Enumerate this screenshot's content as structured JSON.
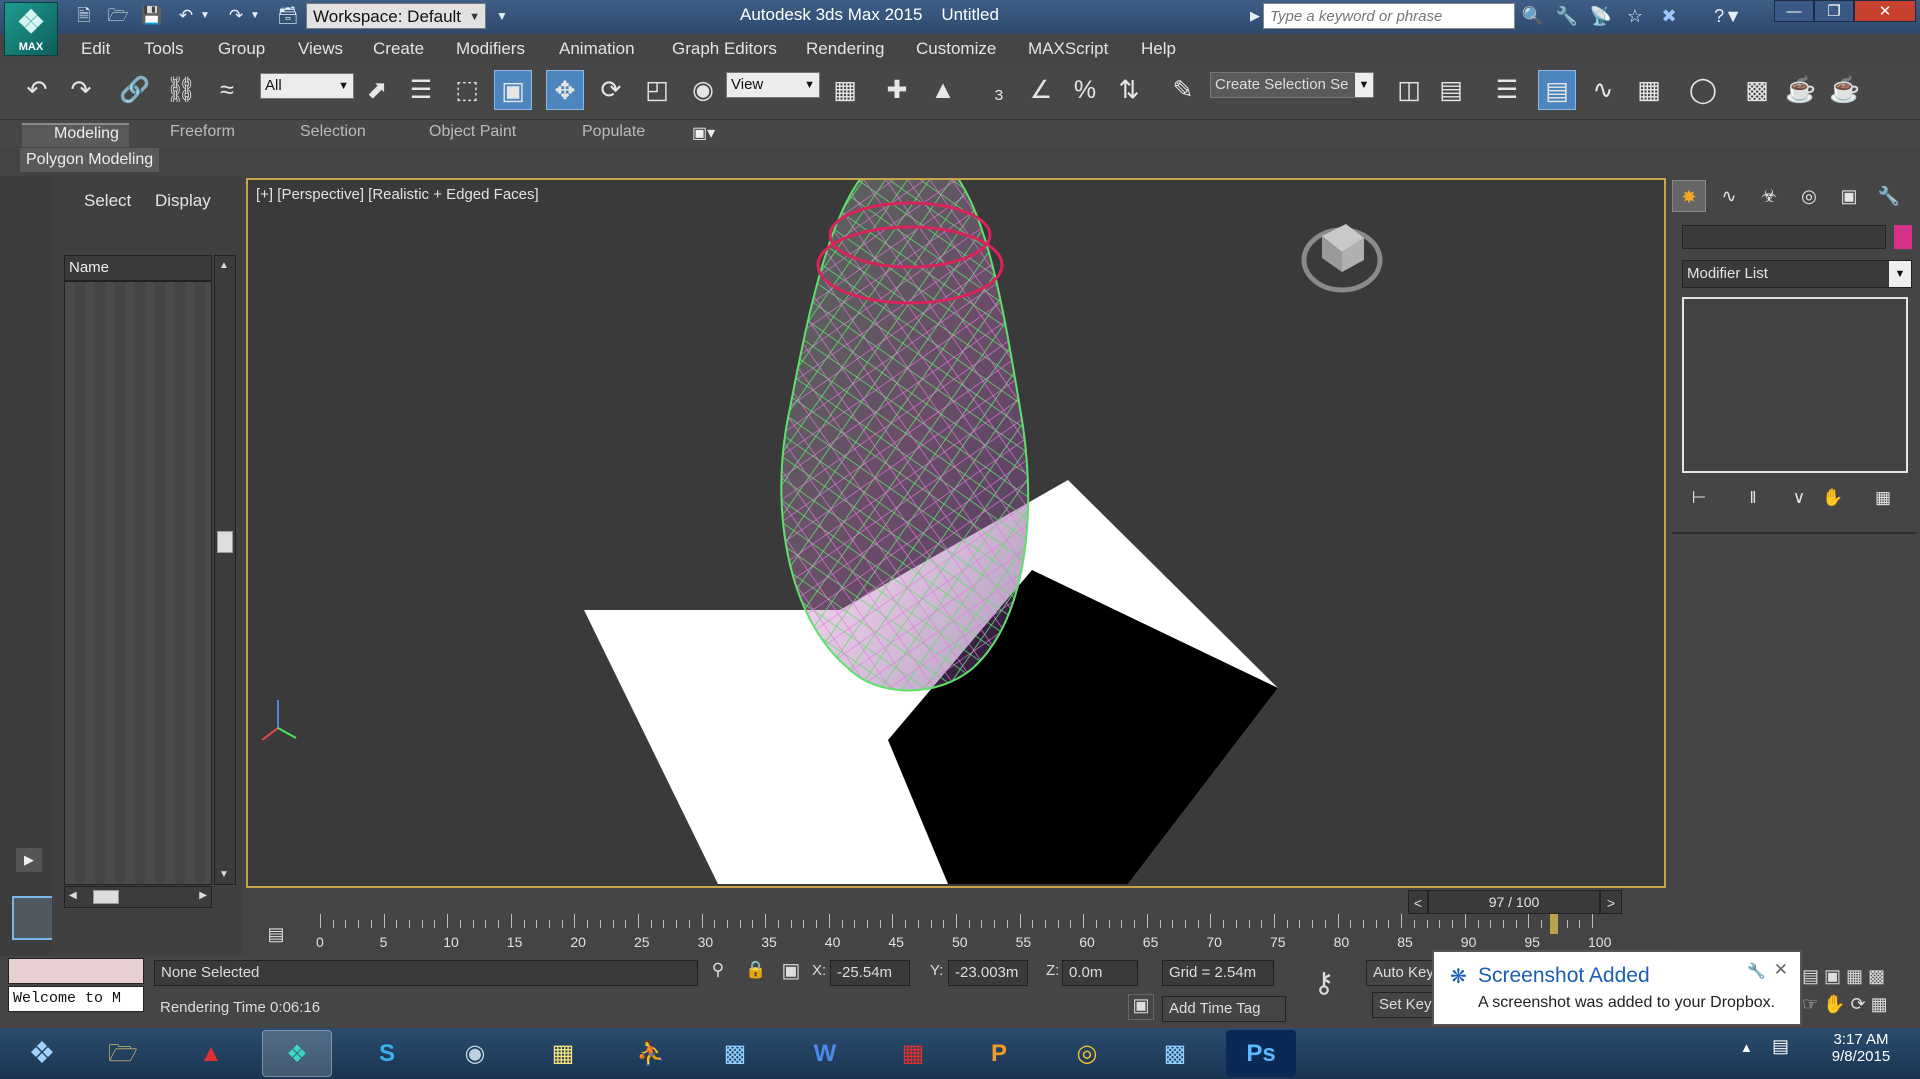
{
  "app": {
    "logo_text": "MAX",
    "workspace": "Workspace: Default",
    "title": "Autodesk 3ds Max 2015",
    "filename": "Untitled",
    "search_placeholder": "Type a keyword or phrase"
  },
  "menu": [
    "Edit",
    "Tools",
    "Group",
    "Views",
    "Create",
    "Modifiers",
    "Animation",
    "Graph Editors",
    "Rendering",
    "Customize",
    "MAXScript",
    "Help"
  ],
  "toolbar": {
    "selection_filter": "All",
    "reference_coord": "View",
    "named_selection": "Create Selection Se"
  },
  "ribbon": {
    "tabs": [
      "Modeling",
      "Freeform",
      "Selection",
      "Object Paint",
      "Populate"
    ],
    "active_tab": "Modeling",
    "panel": "Polygon Modeling"
  },
  "explorer": {
    "tabs": [
      "Select",
      "Display"
    ],
    "column": "Name"
  },
  "viewport": {
    "label_plus": "[+]",
    "label_view": "[Perspective]",
    "label_shading": "[Realistic + Edged Faces]"
  },
  "command_panel": {
    "modifier_list": "Modifier List",
    "object_color": "#d6318b"
  },
  "timeline": {
    "frame_display": "97 / 100",
    "current_frame": 97,
    "total_frames": 100,
    "labels": [
      "0",
      "5",
      "10",
      "15",
      "20",
      "25",
      "30",
      "35",
      "40",
      "45",
      "50",
      "55",
      "60",
      "65",
      "70",
      "75",
      "80",
      "85",
      "90",
      "95",
      "100"
    ]
  },
  "status": {
    "selection": "None Selected",
    "rendering_time": "Rendering Time  0:06:16",
    "maxscript_listener": "Welcome to M",
    "x_label": "X:",
    "x_value": "-25.54m",
    "y_label": "Y:",
    "y_value": "-23.003m",
    "z_label": "Z:",
    "z_value": "0.0m",
    "grid": "Grid = 2.54m",
    "add_time_tag": "Add Time Tag",
    "auto_key": "Auto Key",
    "set_key": "Set Key"
  },
  "notification": {
    "title": "Screenshot Added",
    "body": "A screenshot was added to your Dropbox."
  },
  "taskbar": {
    "time": "3:17 AM",
    "date": "9/8/2015",
    "photoshop_label": "Ps"
  },
  "colors": {
    "accent": "#4d86bf",
    "viewport_border": "#c9a24a",
    "wire_green": "#5ee06a",
    "wire_pink": "#e07bd9",
    "ring_red": "#d8245a"
  }
}
